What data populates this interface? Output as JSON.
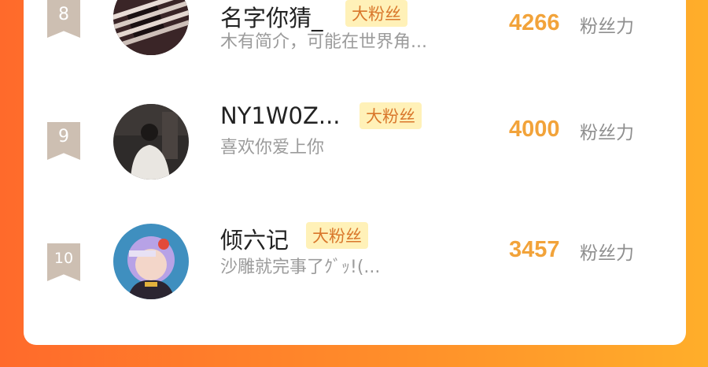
{
  "rows": [
    {
      "rank": "8",
      "name": "名字你猜_",
      "badge": "大粉丝",
      "desc": "木有简介，可能在世界角...",
      "score": "4266",
      "unit": "粉丝力"
    },
    {
      "rank": "9",
      "name": "NY1W0Z...",
      "badge": "大粉丝",
      "desc": "喜欢你爱上你",
      "score": "4000",
      "unit": "粉丝力"
    },
    {
      "rank": "10",
      "name": "倾六记",
      "badge": "大粉丝",
      "desc": "沙雕就完事了ｸﾞｯ!(...",
      "score": "3457",
      "unit": "粉丝力"
    }
  ]
}
